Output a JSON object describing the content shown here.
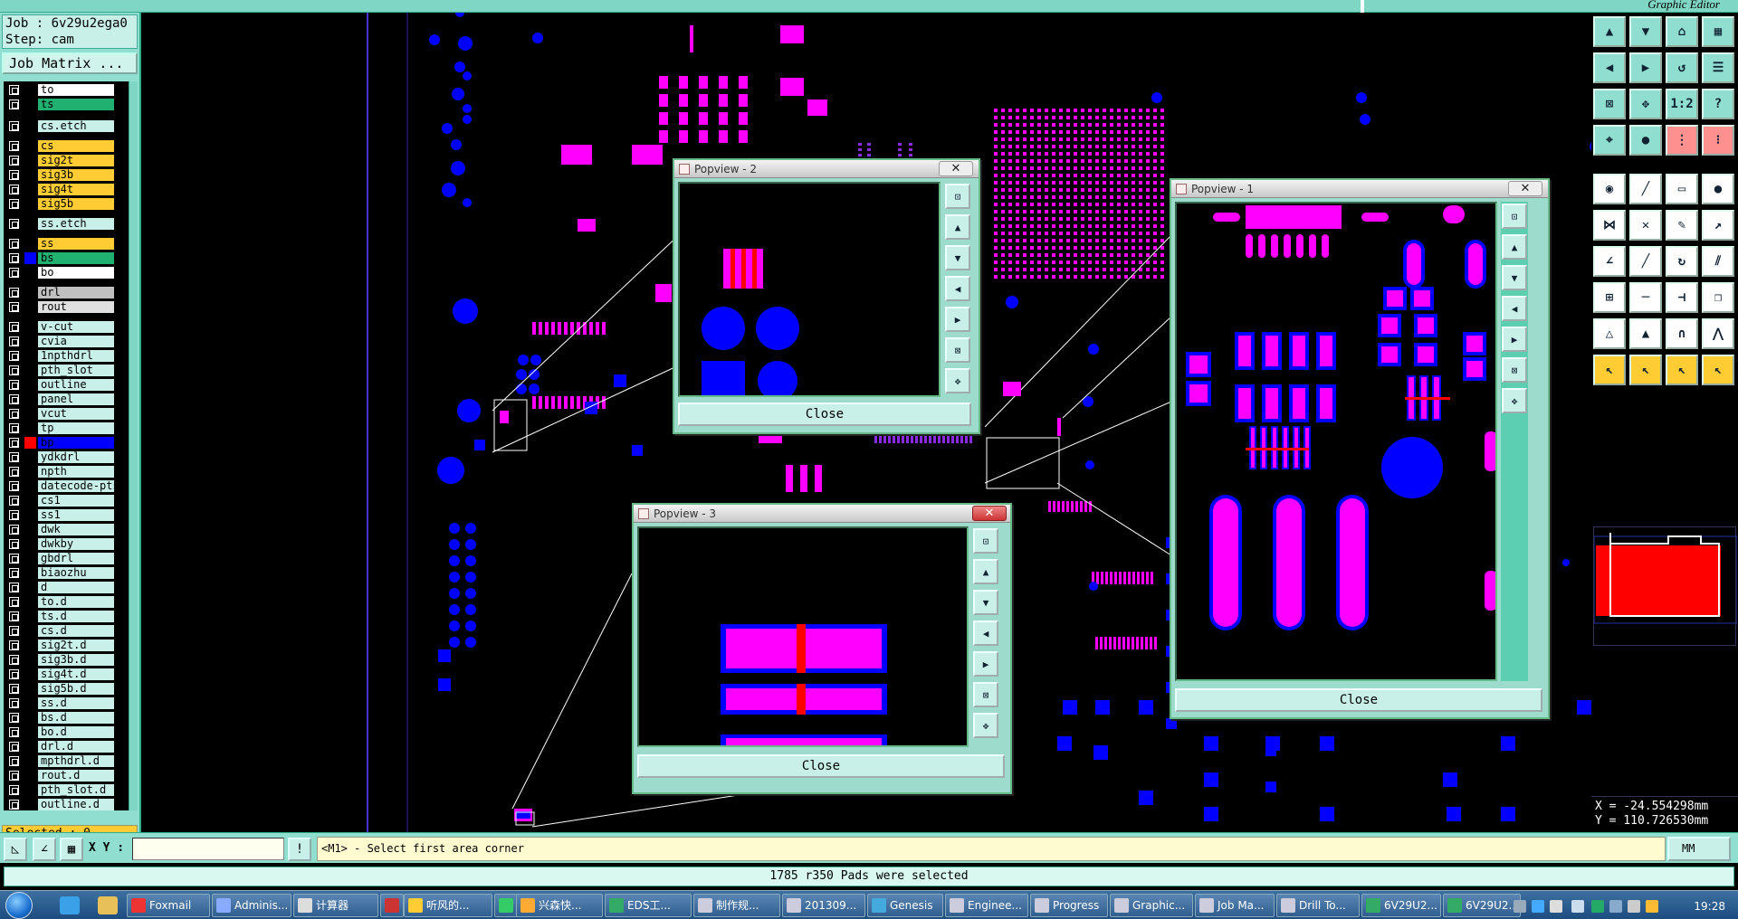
{
  "app": {
    "title": "Graphic Editor"
  },
  "job": {
    "job_line": "Job : 6v29u2ega0",
    "step_line": "Step: cam",
    "matrix_button": "Job Matrix ..."
  },
  "colors": {
    "pink": "#ff00ff",
    "blue": "#0000ff",
    "violet": "#8a2be2",
    "accent": "#8fded0",
    "yellow": "#ffcc33",
    "green": "#20b070"
  },
  "layers": [
    {
      "name": "to",
      "color": "#ffffff"
    },
    {
      "name": "ts",
      "color": "#20b070"
    },
    {
      "name": "cs.etch",
      "color": "#c8f0e8"
    },
    {
      "name": "cs",
      "color": "#ffcc33"
    },
    {
      "name": "sig2t",
      "color": "#ffcc33"
    },
    {
      "name": "sig3b",
      "color": "#ffcc33"
    },
    {
      "name": "sig4t",
      "color": "#ffcc33"
    },
    {
      "name": "sig5b",
      "color": "#ffcc33"
    },
    {
      "name": "ss.etch",
      "color": "#c8f0e8"
    },
    {
      "name": "ss",
      "color": "#ffcc33"
    },
    {
      "name": "bs",
      "color": "#20b070",
      "swatch": "#0000ff"
    },
    {
      "name": "bo",
      "color": "#ffffff"
    },
    {
      "name": "drl",
      "color": "#c0c0c0"
    },
    {
      "name": "rout",
      "color": "#e0e0e0"
    },
    {
      "name": "v-cut",
      "color": "#c8f0e8"
    },
    {
      "name": "cvia",
      "color": "#c8f0e8"
    },
    {
      "name": "1npthdrl",
      "color": "#c8f0e8"
    },
    {
      "name": "pth_slot",
      "color": "#c8f0e8"
    },
    {
      "name": "outline",
      "color": "#c8f0e8"
    },
    {
      "name": "panel",
      "color": "#c8f0e8"
    },
    {
      "name": "vcut",
      "color": "#c8f0e8"
    },
    {
      "name": "tp",
      "color": "#c8f0e8"
    },
    {
      "name": "bp",
      "color": "#0000ff",
      "swatch": "#ff0000"
    },
    {
      "name": "ydkdrl",
      "color": "#c8f0e8"
    },
    {
      "name": "npth",
      "color": "#c8f0e8"
    },
    {
      "name": "datecode-pts",
      "color": "#c8f0e8"
    },
    {
      "name": "cs1",
      "color": "#c8f0e8"
    },
    {
      "name": "ss1",
      "color": "#c8f0e8"
    },
    {
      "name": "dwk",
      "color": "#c8f0e8"
    },
    {
      "name": "dwkby",
      "color": "#c8f0e8"
    },
    {
      "name": "gbdrl",
      "color": "#c8f0e8"
    },
    {
      "name": "biaozhu",
      "color": "#c8f0e8"
    },
    {
      "name": "d",
      "color": "#c8f0e8"
    },
    {
      "name": "to.d",
      "color": "#c8f0e8"
    },
    {
      "name": "ts.d",
      "color": "#c8f0e8"
    },
    {
      "name": "cs.d",
      "color": "#c8f0e8"
    },
    {
      "name": "sig2t.d",
      "color": "#c8f0e8"
    },
    {
      "name": "sig3b.d",
      "color": "#c8f0e8"
    },
    {
      "name": "sig4t.d",
      "color": "#c8f0e8"
    },
    {
      "name": "sig5b.d",
      "color": "#c8f0e8"
    },
    {
      "name": "ss.d",
      "color": "#c8f0e8"
    },
    {
      "name": "bs.d",
      "color": "#c8f0e8"
    },
    {
      "name": "bo.d",
      "color": "#c8f0e8"
    },
    {
      "name": "drl.d",
      "color": "#c8f0e8"
    },
    {
      "name": "mpthdrl.d",
      "color": "#c8f0e8"
    },
    {
      "name": "rout.d",
      "color": "#c8f0e8"
    },
    {
      "name": "pth_slot.d",
      "color": "#c8f0e8"
    },
    {
      "name": "outline.d",
      "color": "#c8f0e8"
    }
  ],
  "selected": "Selected : 0",
  "popviews": [
    {
      "title": "Popview - 2",
      "close": "Close"
    },
    {
      "title": "Popview - 1",
      "close": "Close"
    },
    {
      "title": "Popview - 3",
      "close": "Close"
    }
  ],
  "command": {
    "xy_label": "X Y :",
    "prompt": "<M1> - Select first area corner",
    "units": "MM"
  },
  "status": "1785 r350 Pads were selected",
  "coords": {
    "x": "X = -24.554298mm",
    "y": "Y = 110.726530mm"
  },
  "tools": [
    "zoom-home-icon",
    "zoom-in-icon",
    "home-icon",
    "grid-icon",
    "pan-left-icon",
    "pan-right-icon",
    "reset-icon",
    "layout-icon",
    "fit-icon",
    "center-icon",
    "ratio-icon",
    "help-icon",
    "measure-icon",
    "pad-icon",
    "snap-icon",
    "drill-icon",
    "add-pad-icon",
    "line-icon",
    "ruler-icon",
    "circle-icon",
    "connect-icon",
    "delete-icon",
    "edit-icon",
    "move-icon",
    "angle-icon",
    "arc-icon",
    "rotate-icon",
    "mirror-icon",
    "feature-icon",
    "select-icon",
    "dimension-icon",
    "copy-icon",
    "triangle-icon",
    "polygon-icon",
    "arch-icon",
    "peak-icon",
    "pointer-icon",
    "pointer-fill-icon",
    "pointer-box-icon",
    "pointer-multi-icon"
  ],
  "toolbar_labels": {
    "ratio": "1:2",
    "help": "?"
  },
  "taskbar": {
    "items": [
      "Foxmail",
      "Adminis...",
      "计算器",
      "",
      "听风的...",
      "",
      "兴森快...",
      "EDS工...",
      "制作规...",
      "201309...",
      "Genesis",
      "Enginee...",
      "Progress",
      "Graphic...",
      "Job Ma...",
      "Drill To...",
      "6V29U2...",
      "6V29U2..."
    ],
    "clock": "19:28"
  }
}
